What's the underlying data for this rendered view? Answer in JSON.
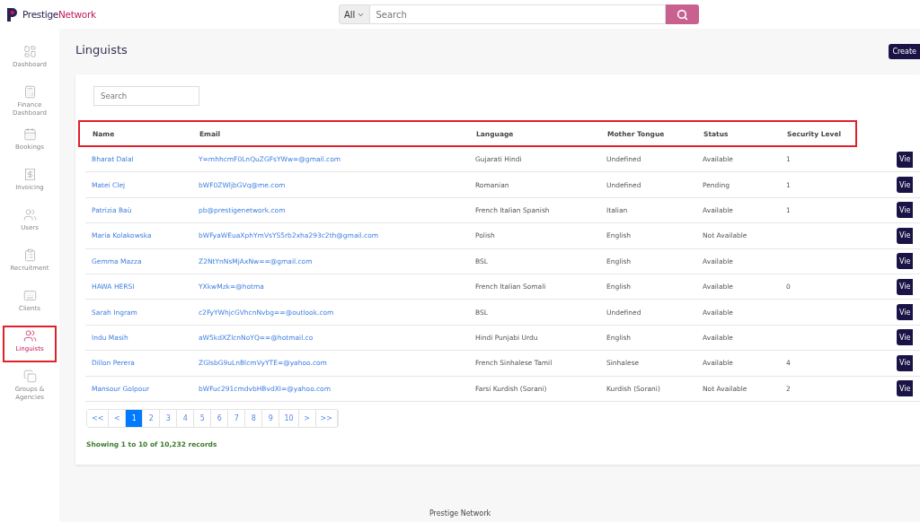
{
  "brand": {
    "part_1": "Prestige",
    "part_2": "Network"
  },
  "search_bar": {
    "scope": "All",
    "placeholder": "Search"
  },
  "sidebar": {
    "items": [
      {
        "label": "Dashboard",
        "selected": false,
        "highlighted": false
      },
      {
        "label": "Finance Dashboard",
        "selected": false,
        "highlighted": false
      },
      {
        "label": "Bookings",
        "selected": false,
        "highlighted": false
      },
      {
        "label": "Invoicing",
        "selected": false,
        "highlighted": false
      },
      {
        "label": "Users",
        "selected": false,
        "highlighted": false
      },
      {
        "label": "Recruitment",
        "selected": false,
        "highlighted": false
      },
      {
        "label": "Clients",
        "selected": false,
        "highlighted": false
      },
      {
        "label": "Linguists",
        "selected": true,
        "highlighted": true
      },
      {
        "label": "Groups & Agencies",
        "selected": false,
        "highlighted": false
      }
    ]
  },
  "page": {
    "title": "Linguists",
    "create_button": "Create"
  },
  "table": {
    "search_placeholder": "Search",
    "header_highlighted": true,
    "columns": [
      "Name",
      "Email",
      "Language",
      "Mother Tongue",
      "Status",
      "Security Level"
    ],
    "rows": [
      {
        "name": "Bharat Dalal",
        "email": "Y=mhhcmF0LnQuZGFsYWw=@gmail.com",
        "language": "Gujarati Hindi",
        "mother_tongue": "Undefined",
        "status": "Available",
        "security_level": "1",
        "action": "Vie"
      },
      {
        "name": "Matei Clej",
        "email": "bWF0ZWljbGVq@me.com",
        "language": "Romanian",
        "mother_tongue": "Undefined",
        "status": "Pending",
        "security_level": "1",
        "action": "Vie"
      },
      {
        "name": "Patrizia Baù",
        "email": "pb@prestigenetwork.com",
        "language": "French Italian Spanish",
        "mother_tongue": "Italian",
        "status": "Available",
        "security_level": "1",
        "action": "Vie"
      },
      {
        "name": "Maria Kolakowska",
        "email": "bWFyaWEuaXphYmVsYS5rb2xha293c2th@gmail.com",
        "language": "Polish",
        "mother_tongue": "English",
        "status": "Not Available",
        "action": "Vie"
      },
      {
        "name": "Gemma Mazza",
        "email": "Z2NtYnNsMjAxNw==@gmail.com",
        "language": "BSL",
        "mother_tongue": "English",
        "status": "Available",
        "action": "Vie"
      },
      {
        "name": "HAWA HERSI",
        "email": "YXkwMzk=@hotma",
        "language": "French Italian Somali",
        "mother_tongue": "English",
        "status": "Available",
        "security_level": "0",
        "action": "Vie"
      },
      {
        "name": "Sarah Ingram",
        "email": "c2FyYWhjcGVhcnNvbg==@outlook.com",
        "language": "BSL",
        "mother_tongue": "Undefined",
        "status": "Available",
        "action": "Vie"
      },
      {
        "name": "Indu Masih",
        "email": "aW5kdXZlcnNoYQ==@hotmail.co",
        "language": "Hindi Punjabi Urdu",
        "mother_tongue": "English",
        "status": "Available",
        "action": "Vie"
      },
      {
        "name": "Dillon Perera",
        "email": "ZGlsbG9uLnBlcmVyYTE=@yahoo.com",
        "language": "French Sinhalese Tamil",
        "mother_tongue": "Sinhalese",
        "status": "Available",
        "security_level": "4",
        "action": "Vie"
      },
      {
        "name": "Mansour Golpour",
        "email": "bWFuc291cmdvbHBvdXI=@yahoo.com",
        "language": "Farsi Kurdish (Sorani)",
        "mother_tongue": "Kurdish (Sorani)",
        "status": "Not Available",
        "security_level": "2",
        "action": "Vie"
      }
    ]
  },
  "pagination": {
    "pages": [
      {
        "label": "<<",
        "selected": false
      },
      {
        "label": "<",
        "selected": false
      },
      {
        "label": "1",
        "selected": true
      },
      {
        "label": "2",
        "selected": false
      },
      {
        "label": "3",
        "selected": false
      },
      {
        "label": "4",
        "selected": false
      },
      {
        "label": "5",
        "selected": false
      },
      {
        "label": "6",
        "selected": false
      },
      {
        "label": "7",
        "selected": false
      },
      {
        "label": "8",
        "selected": false
      },
      {
        "label": "9",
        "selected": false
      },
      {
        "label": "10",
        "selected": false
      },
      {
        "label": ">",
        "selected": false
      },
      {
        "label": ">>",
        "selected": false
      }
    ],
    "summary": "Showing 1 to 10 of 10,232 records"
  },
  "footer": "Prestige Network"
}
